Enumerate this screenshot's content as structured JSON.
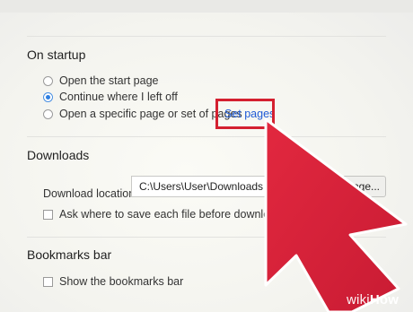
{
  "sections": {
    "startup": {
      "title": "On startup",
      "options": [
        {
          "label": "Open the start page",
          "selected": false
        },
        {
          "label": "Continue where I left off",
          "selected": true
        },
        {
          "label": "Open a specific page or set of pages",
          "selected": false
        }
      ],
      "set_pages_link": "Set pages"
    },
    "downloads": {
      "title": "Downloads",
      "location_label": "Download location:",
      "location_value": "C:\\Users\\User\\Downloads",
      "change_button": "Change...",
      "ask_label": "Ask where to save each file before downloading"
    },
    "bookmarks": {
      "title": "Bookmarks bar",
      "show_label": "Show the bookmarks bar"
    }
  },
  "watermark": {
    "prefix": "wiki",
    "suffix": "How"
  },
  "colors": {
    "highlight": "#d42030",
    "cursor": "#d8213b",
    "link": "#1f5bd6"
  },
  "icons": [
    "cursor-arrow-icon"
  ]
}
